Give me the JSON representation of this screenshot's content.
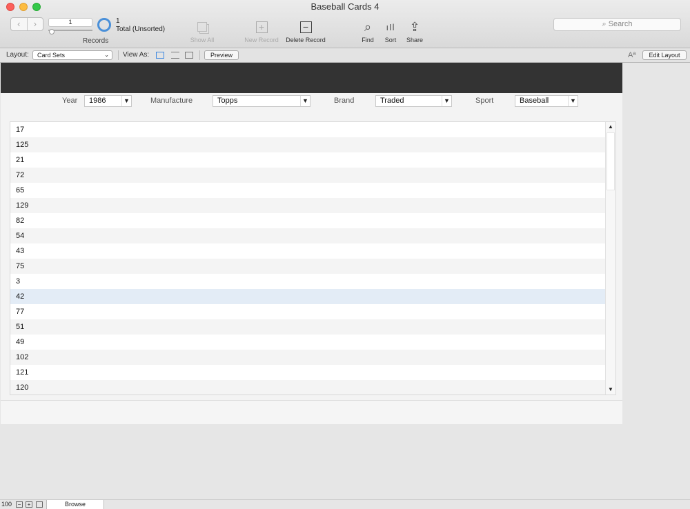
{
  "window": {
    "title": "Baseball Cards 4"
  },
  "toolbar": {
    "record_number": "1",
    "records_label": "Records",
    "found_count": "1",
    "total_label": "Total (Unsorted)",
    "show_all": "Show All",
    "new_record": "New Record",
    "delete_record": "Delete Record",
    "find": "Find",
    "sort": "Sort",
    "share": "Share",
    "search_placeholder": "Search"
  },
  "layout_bar": {
    "layout_label": "Layout:",
    "layout_value": "Card Sets",
    "view_as_label": "View As:",
    "preview": "Preview",
    "edit_layout": "Edit Layout",
    "text_format_glyph": "Aª"
  },
  "filters": {
    "year_label": "Year",
    "year_value": "1986",
    "manufacture_label": "Manufacture",
    "manufacture_value": "Topps",
    "brand_label": "Brand",
    "brand_value": "Traded",
    "sport_label": "Sport",
    "sport_value": "Baseball"
  },
  "list": {
    "rows": [
      "17",
      "125",
      "21",
      "72",
      "65",
      "129",
      "82",
      "54",
      "43",
      "75",
      "3",
      "42",
      "77",
      "51",
      "49",
      "102",
      "121",
      "120"
    ],
    "selected_index": 11
  },
  "status_bar": {
    "zoom": "100",
    "mode": "Browse"
  },
  "colors": {
    "accent": "#4a90d9",
    "header_band": "#333333",
    "selected_row": "#e3ecf6"
  }
}
